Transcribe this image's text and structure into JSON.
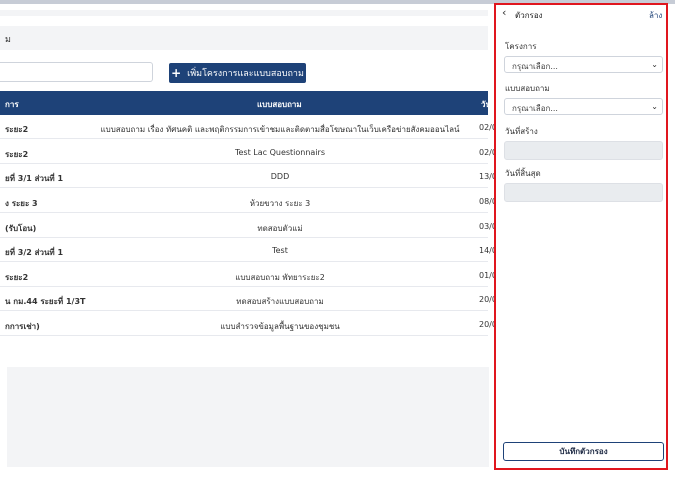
{
  "section": {
    "title": "ม"
  },
  "toolbar": {
    "add_button_label": "เพิ่มโครงการและแบบสอบถาม",
    "add_icon": "plus-icon"
  },
  "table": {
    "headers": {
      "project": "การ",
      "questionnaire": "แบบสอบถาม",
      "date": "วัน"
    },
    "rows": [
      {
        "project": "ระยะ2",
        "questionnaire": "แบบสอบถาม เรื่อง ทัศนคติ และพฤติกรรมการเข้าชมและติดตามสื่อโฆษณาในเว็บเครือข่ายสังคมออนไลน์",
        "date": "02/0"
      },
      {
        "project": "ระยะ2",
        "questionnaire": "Test Lac Questionnairs",
        "date": "02/0"
      },
      {
        "project": "ยที่ 3/1 ส่วนที่ 1",
        "questionnaire": "DDD",
        "date": "13/0"
      },
      {
        "project": "ง ระยะ 3",
        "questionnaire": "ห้วยขวาง ระยะ 3",
        "date": "08/0"
      },
      {
        "project": "(รับโอน)",
        "questionnaire": "ทดสอบตัวแม่",
        "date": "03/0"
      },
      {
        "project": "ยที่ 3/2 ส่วนที่ 1",
        "questionnaire": "Test",
        "date": "14/0"
      },
      {
        "project": "ระยะ2",
        "questionnaire": "แบบสอบถาม พัทยาระยะ2",
        "date": "01/0"
      },
      {
        "project": "น กม.44 ระยะที่ 1/3T",
        "questionnaire": "ทดสอบสร้างแบบสอบถาม",
        "date": "20/0"
      },
      {
        "project": "กการเช่า)",
        "questionnaire": "แบบสำรวจข้อมูลพื้นฐานของชุมชน",
        "date": "20/0"
      }
    ]
  },
  "filter_panel": {
    "title": "ตัวกรอง",
    "clear_label": "ล้าง",
    "back_icon": "chevron-left-icon",
    "project_label": "โครงการ",
    "project_value": "กรุณาเลือก...",
    "questionnaire_label": "แบบสอบถาม",
    "questionnaire_value": "กรุณาเลือก...",
    "created_label": "วันที่สร้าง",
    "end_label": "วันที่สิ้นสุด",
    "save_label": "บันทึกตัวกรอง"
  },
  "colors": {
    "primary": "#1e4278",
    "highlight": "#e0161e",
    "panel_bg": "#f3f4f6"
  }
}
